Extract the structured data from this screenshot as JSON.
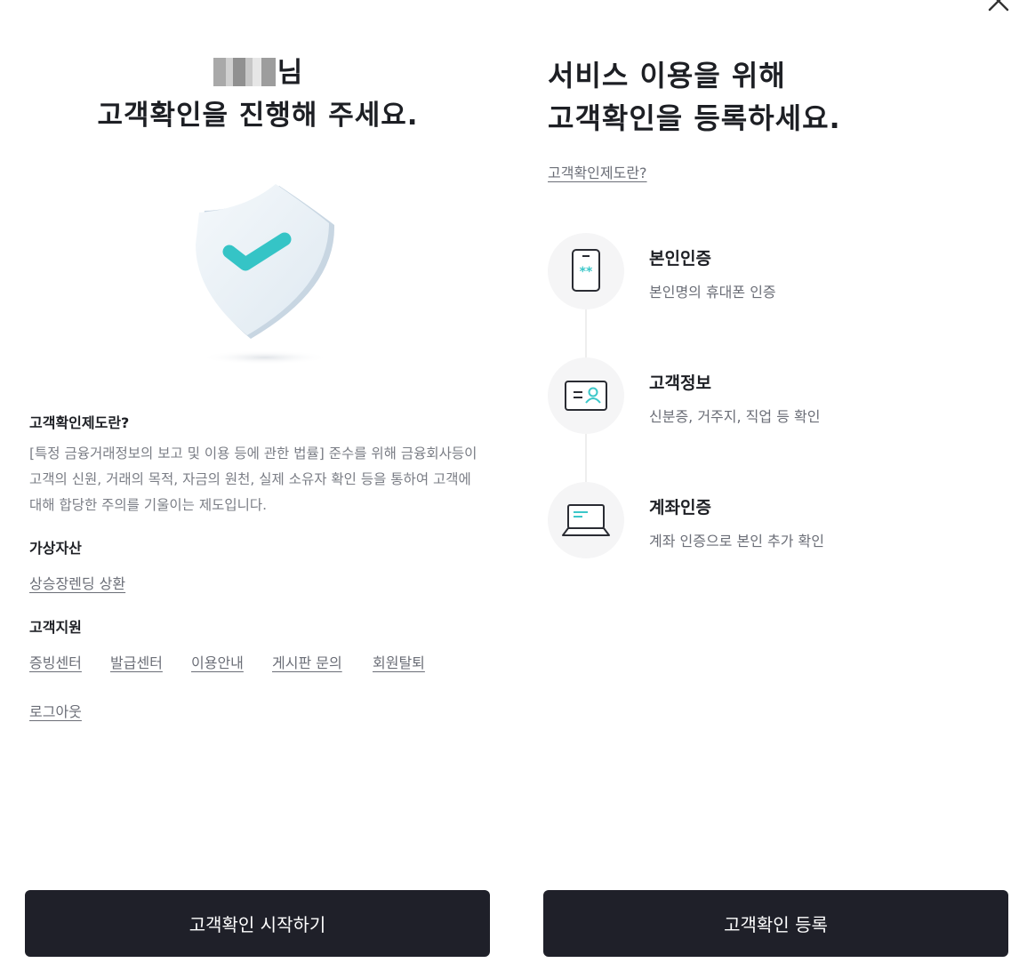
{
  "left": {
    "greeting_suffix": "님",
    "greeting_line2": "고객확인을 진행해 주세요.",
    "info": {
      "title": "고객확인제도란?",
      "body": "[특정 금융거래정보의 보고 및 이용 등에 관한 법률] 준수를 위해 금융회사등이 고객의 신원, 거래의 목적, 자금의 원천, 실제 소유자 확인 등을 통하여 고객에 대해 합당한 주의를 기울이는 제도입니다."
    },
    "crypto": {
      "title": "가상자산",
      "link": "상승장렌딩 상환"
    },
    "support": {
      "title": "고객지원",
      "links": [
        "증빙센터",
        "발급센터",
        "이용안내",
        "게시판 문의",
        "회원탈퇴"
      ]
    },
    "logout": "로그아웃",
    "start_button": "고객확인 시작하기"
  },
  "right": {
    "title_line1": "서비스 이용을 위해",
    "title_line2": "고객확인을 등록하세요.",
    "info_link": "고객확인제도란?",
    "steps": [
      {
        "title": "본인인증",
        "desc": "본인명의 휴대폰 인증",
        "icon": "phone-icon"
      },
      {
        "title": "고객정보",
        "desc": "신분증, 거주지, 직업 등 확인",
        "icon": "id-card-icon"
      },
      {
        "title": "계좌인증",
        "desc": "계좌 인증으로 본인 추가 확인",
        "icon": "laptop-icon"
      }
    ],
    "register_button": "고객확인 등록"
  },
  "colors": {
    "button_bg": "#1f2029",
    "accent_teal": "#3cc7c9",
    "muted_text": "#7a7d85"
  }
}
